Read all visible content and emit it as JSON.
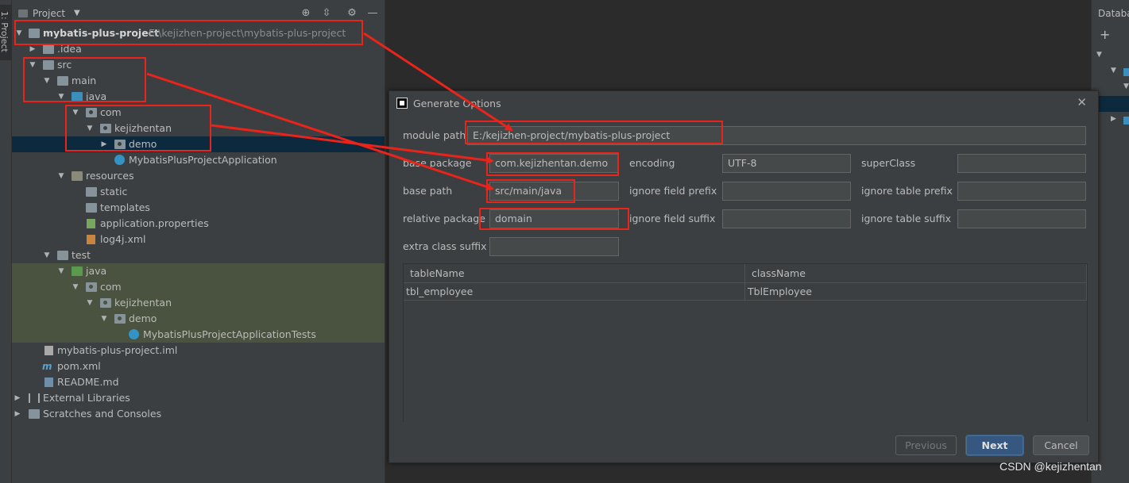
{
  "tool_strip": {
    "tab_label": "1: Project"
  },
  "project_panel": {
    "title": "Project",
    "tree": [
      {
        "label": "mybatis-plus-project",
        "path": "E:\\kejizhen-project\\mybatis-plus-project",
        "kind": "module",
        "expanded": true
      },
      {
        "label": ".idea",
        "kind": "folder",
        "expanded": false
      },
      {
        "label": "src",
        "kind": "folder",
        "expanded": true
      },
      {
        "label": "main",
        "kind": "folder",
        "expanded": true
      },
      {
        "label": "java",
        "kind": "source-folder",
        "expanded": true
      },
      {
        "label": "com",
        "kind": "package",
        "expanded": true
      },
      {
        "label": "kejizhentan",
        "kind": "package",
        "expanded": true
      },
      {
        "label": "demo",
        "kind": "package",
        "expanded": false,
        "selected": true
      },
      {
        "label": "MybatisPlusProjectApplication",
        "kind": "class"
      },
      {
        "label": "resources",
        "kind": "resources-folder",
        "expanded": true
      },
      {
        "label": "static",
        "kind": "folder"
      },
      {
        "label": "templates",
        "kind": "folder"
      },
      {
        "label": "application.properties",
        "kind": "properties-file"
      },
      {
        "label": "log4j.xml",
        "kind": "xml-file"
      },
      {
        "label": "test",
        "kind": "folder",
        "expanded": true
      },
      {
        "label": "java",
        "kind": "test-source-folder",
        "expanded": true
      },
      {
        "label": "com",
        "kind": "package",
        "expanded": true
      },
      {
        "label": "kejizhentan",
        "kind": "package",
        "expanded": true
      },
      {
        "label": "demo",
        "kind": "package",
        "expanded": true
      },
      {
        "label": "MybatisPlusProjectApplicationTests",
        "kind": "class"
      },
      {
        "label": "mybatis-plus-project.iml",
        "kind": "file"
      },
      {
        "label": "pom.xml",
        "kind": "maven-file"
      },
      {
        "label": "README.md",
        "kind": "md-file"
      },
      {
        "label": "External Libraries",
        "kind": "libraries",
        "expanded": false
      },
      {
        "label": "Scratches and Consoles",
        "kind": "scratches",
        "expanded": false
      }
    ]
  },
  "db_panel": {
    "title": "Databa"
  },
  "dialog": {
    "title": "Generate Options",
    "fields": {
      "module_path": {
        "label": "module path",
        "value": "E:/kejizhen-project/mybatis-plus-project"
      },
      "base_package": {
        "label": "base package",
        "value": "com.kejizhentan.demo"
      },
      "encoding": {
        "label": "encoding",
        "value": "UTF-8"
      },
      "super_class": {
        "label": "superClass",
        "value": ""
      },
      "base_path": {
        "label": "base path",
        "value": "src/main/java"
      },
      "ignore_field_prefix": {
        "label": "ignore field prefix",
        "value": ""
      },
      "ignore_table_prefix": {
        "label": "ignore table prefix",
        "value": ""
      },
      "relative_package": {
        "label": "relative package",
        "value": "domain"
      },
      "ignore_field_suffix": {
        "label": "ignore field suffix",
        "value": ""
      },
      "ignore_table_suffix": {
        "label": "ignore table suffix",
        "value": ""
      },
      "extra_class_suffix": {
        "label": "extra class suffix",
        "value": ""
      }
    },
    "table": {
      "columns": [
        "tableName",
        "className"
      ],
      "rows": [
        [
          "tbl_employee",
          "TblEmployee"
        ]
      ]
    },
    "buttons": {
      "previous": "Previous",
      "next": "Next",
      "cancel": "Cancel"
    }
  },
  "annotation_color": "#e8241b",
  "watermark": "CSDN @kejizhentan"
}
